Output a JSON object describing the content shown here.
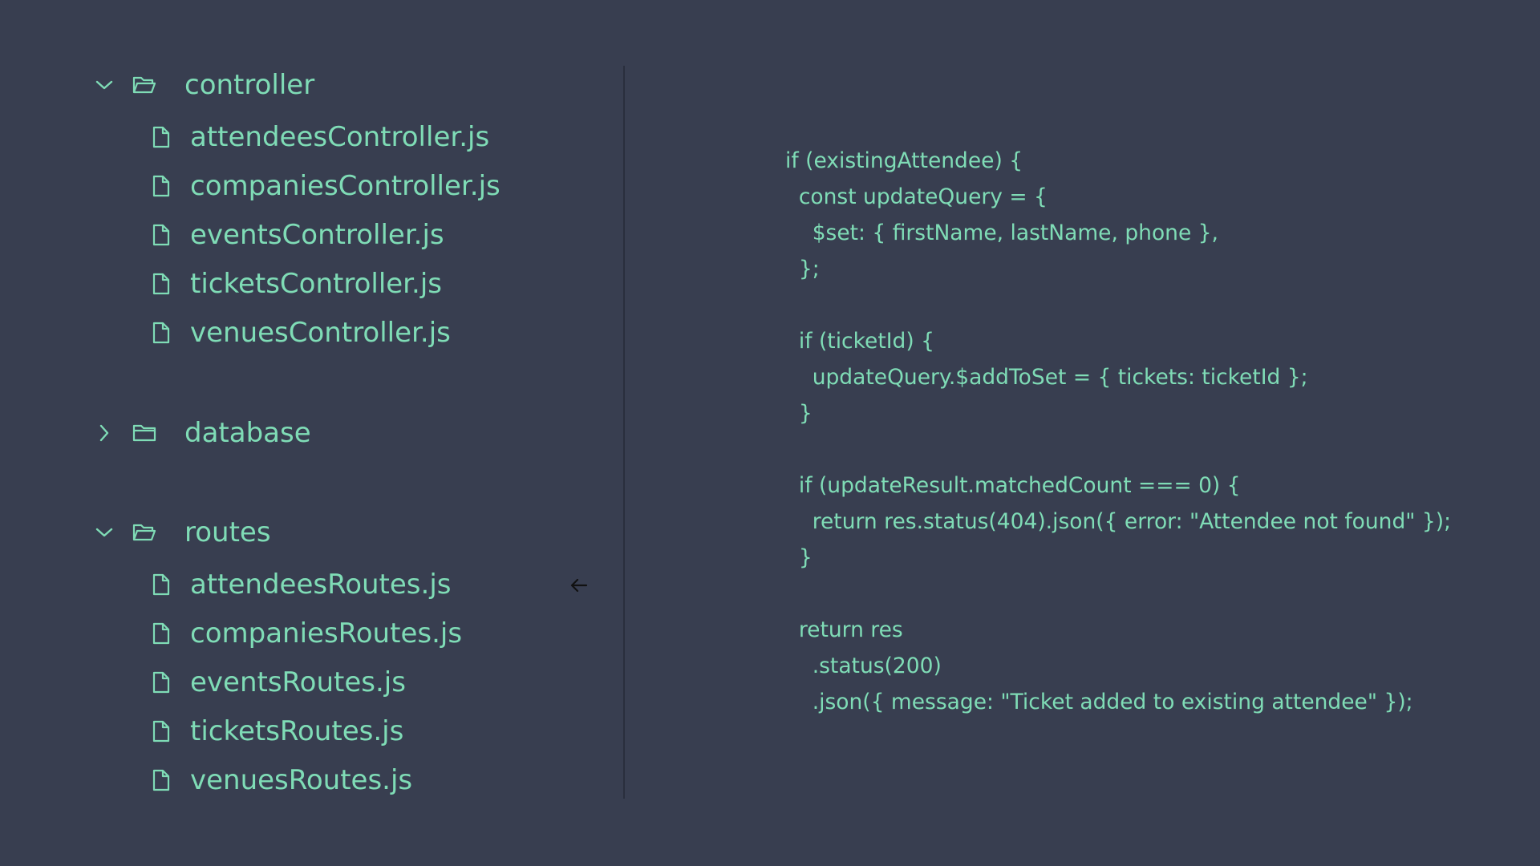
{
  "colors": {
    "background": "#383e50",
    "accent": "#7fdcb6",
    "divider": "#2a2f3d",
    "pointer": "#111111"
  },
  "explorer": {
    "folders": [
      {
        "name": "controller",
        "expanded": true,
        "chevron_icon": "chevron-down-icon",
        "folder_icon": "folder-open-icon",
        "files": [
          "attendeesController.js",
          "companiesController.js",
          "eventsController.js",
          "ticketsController.js",
          "venuesController.js"
        ]
      },
      {
        "name": "database",
        "expanded": false,
        "chevron_icon": "chevron-right-icon",
        "folder_icon": "folder-closed-icon",
        "files": []
      },
      {
        "name": "routes",
        "expanded": true,
        "chevron_icon": "chevron-down-icon",
        "folder_icon": "folder-open-icon",
        "files": [
          "attendeesRoutes.js",
          "companiesRoutes.js",
          "eventsRoutes.js",
          "ticketsRoutes.js",
          "venuesRoutes.js"
        ]
      }
    ],
    "file_icon": "file-icon",
    "pointer_icon": "arrow-left-icon"
  },
  "code": {
    "lines": [
      "if (existingAttendee) {",
      "  const updateQuery = {",
      "    $set: { firstName, lastName, phone },",
      "  };",
      "",
      "  if (ticketId) {",
      "    updateQuery.$addToSet = { tickets: ticketId };",
      "  }",
      "",
      "  if (updateResult.matchedCount === 0) {",
      "    return res.status(404).json({ error: \"Attendee not found\" });",
      "  }",
      "",
      "  return res",
      "    .status(200)",
      "    .json({ message: \"Ticket added to existing attendee\" });"
    ]
  }
}
